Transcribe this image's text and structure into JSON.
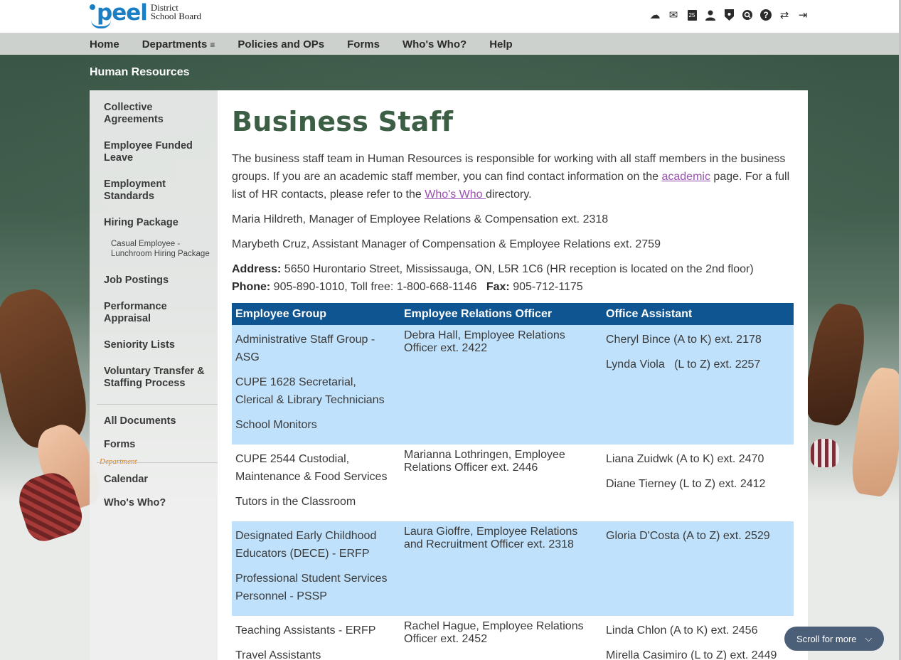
{
  "brand": {
    "logo_word": "peel",
    "line1": "District",
    "line2": "School Board"
  },
  "top_icons": [
    "cloud-icon",
    "mail-icon",
    "calendar-icon",
    "user-icon",
    "shield-icon",
    "search-icon",
    "help-icon",
    "transfer-icon",
    "logout-icon"
  ],
  "top_icon_glyphs": {
    "cloud": "☁",
    "mail": "✉",
    "calendar": "25",
    "user": "👤",
    "shield": "⛊",
    "search": "◉",
    "help": "?",
    "transfer": "⇄",
    "logout": "⇥"
  },
  "nav": {
    "home": "Home",
    "departments": "Departments",
    "departments_glyph": "≡",
    "policies": "Policies and OPs",
    "forms": "Forms",
    "whos_who": "Who's Who?",
    "help": "Help"
  },
  "section_title": "Human Resources",
  "sidebar": {
    "collective": "Collective Agreements",
    "employee_funded": "Employee Funded Leave",
    "employment_standards": "Employment Standards",
    "hiring_package": "Hiring Package",
    "casual_employee": "Casual Employee - Lunchroom Hiring Package",
    "job_postings": "Job Postings",
    "performance": "Performance Appraisal",
    "seniority": "Seniority Lists",
    "voluntary": "Voluntary Transfer & Staffing Process",
    "all_documents": "All Documents",
    "forms": "Forms",
    "department_label": "Department",
    "calendar": "Calendar",
    "whos_who": "Who's Who?"
  },
  "content": {
    "title": "Business Staff",
    "intro_1": "The business staff team in Human Resources is responsible for working with all staff members in the business groups.  If you are an academic staff member, you can find contact information on the ",
    "intro_link_1": "academic",
    "intro_2": " page.  For a full list of HR contacts, please refer to the ",
    "intro_link_2": "Who's Who ",
    "intro_3": "directory.",
    "manager": "Maria Hildreth, Manager of Employee Relations & Compensation ext. 2318",
    "assistant_manager": "Marybeth Cruz, Assistant Manager of Compensation & Employee Relations ext. 2759",
    "address_label": "Address:",
    "address": " 5650 Hurontario Street, Mississauga, ON, L5R 1C6 (HR reception is located on the 2nd floor)",
    "phone_label": "Phone:",
    "phone": " 905-890-1010, Toll free: 1-800-668-1146   ",
    "fax_label": "Fax:",
    "fax": " 905-712-1175"
  },
  "table": {
    "headers": [
      "Employee Group",
      "Employee Relations Officer",
      "Office Assistant"
    ],
    "rows": [
      {
        "groups": [
          "Administrative Staff Group - ASG",
          "CUPE 1628 Secretarial, Clerical & Library Technicians",
          "School Monitors"
        ],
        "officer": "Debra Hall, Employee Relations Officer ext. 2422",
        "assistants": [
          "Cheryl Bince (A to K) ext. 2178",
          "Lynda Viola   (L to Z) ext. 2257"
        ]
      },
      {
        "groups": [
          "CUPE 2544 Custodial, Maintenance & Food Services",
          "Tutors in the Classroom"
        ],
        "officer": "Marianna Lothringen, Employee Relations Officer ext. 2446",
        "assistants": [
          "Liana Zuidwk (A to K) ext. 2470",
          "Diane Tierney (L to Z) ext. 2412"
        ]
      },
      {
        "groups": [
          "Designated Early Childhood Educators (DECE) - ERFP",
          "Professional Student Services Personnel - PSSP"
        ],
        "officer": "Laura Gioffre, Employee Relations and Recruitment Officer ext. 2318",
        "assistants": [
          "Gloria D'Costa (A to Z) ext. 2529"
        ]
      },
      {
        "groups": [
          "Teaching Assistants - ERFP",
          "Travel Assistants"
        ],
        "officer": "Rachel Hague, Employee Relations Officer ext. 2452",
        "assistants": [
          "Linda Chlon (A to K) ext. 2456",
          "Mirella Casimiro (L to Z) ext. 2449"
        ]
      }
    ]
  },
  "scroll_button": {
    "label": "Scroll for more",
    "glyph": "⌵"
  },
  "colors": {
    "brand_blue": "#1a7fc4",
    "title_green": "#3b5e45",
    "table_header": "#0e5591",
    "row_shade": "#bfe1fb",
    "link": "#9a50b0",
    "accent_orange": "#d47a1a"
  }
}
